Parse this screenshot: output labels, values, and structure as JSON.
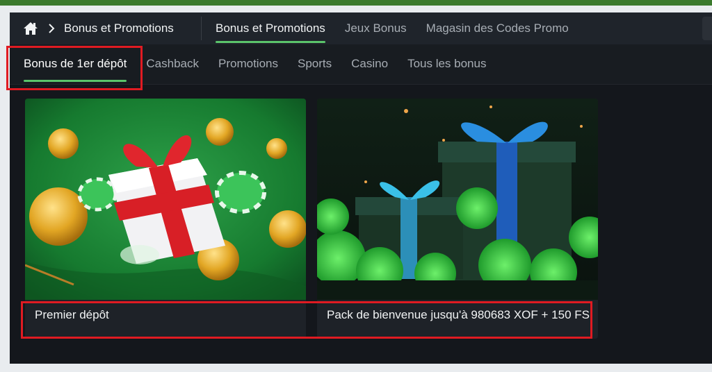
{
  "breadcrumb": {
    "home_icon": "home-icon",
    "separator_icon": "chevron-right-icon",
    "label": "Bonus et Promotions"
  },
  "header_tabs": [
    {
      "label": "Bonus et Promotions",
      "active": true
    },
    {
      "label": "Jeux Bonus",
      "active": false
    },
    {
      "label": "Magasin des Codes Promo",
      "active": false
    }
  ],
  "category_tabs": [
    {
      "label": "Bonus de 1er dépôt",
      "active": true
    },
    {
      "label": "Cashback",
      "active": false
    },
    {
      "label": "Promotions",
      "active": false
    },
    {
      "label": "Sports",
      "active": false
    },
    {
      "label": "Casino",
      "active": false
    },
    {
      "label": "Tous les bonus",
      "active": false
    }
  ],
  "cards": [
    {
      "title": "Premier dépôt",
      "image": "gift-box-with-coins-illustration"
    },
    {
      "title": "Pack de bienvenue jusqu'à 980683 XOF + 150 FS",
      "image": "two-gift-boxes-green-smoke-illustration"
    }
  ],
  "colors": {
    "accent": "#5bc46b",
    "highlight_box": "#e01b22",
    "background": "#14171c"
  }
}
